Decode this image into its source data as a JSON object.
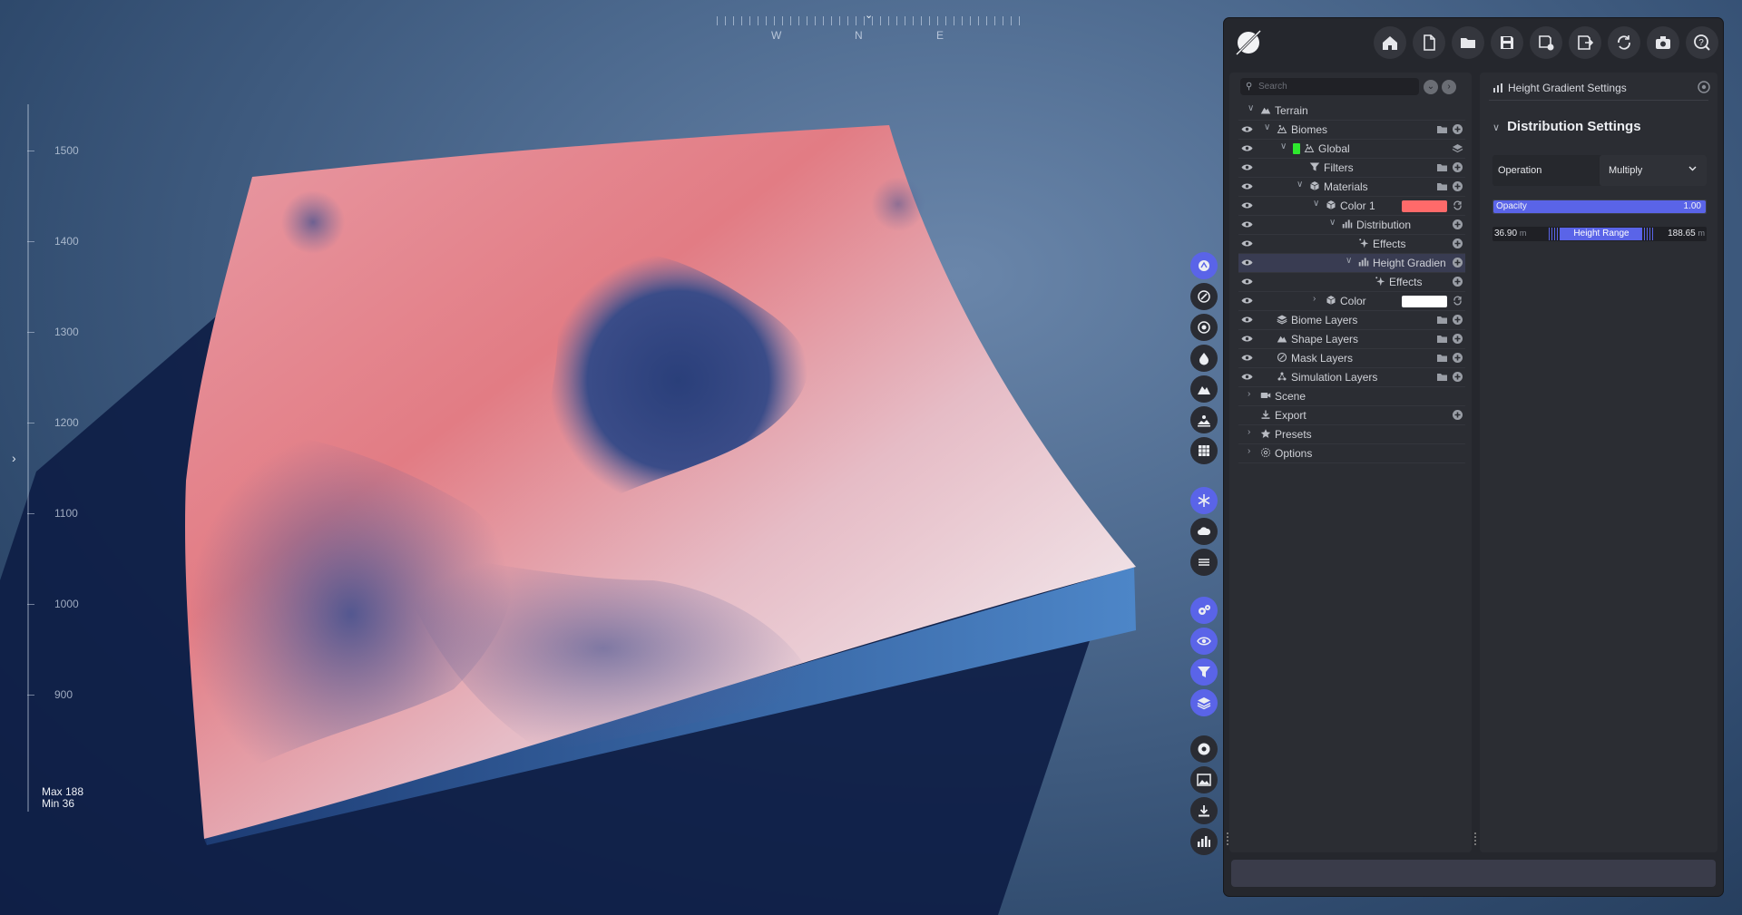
{
  "compass": {
    "labels": [
      "W",
      "N",
      "E"
    ]
  },
  "ruler": {
    "ticks": [
      "1500",
      "1400",
      "1300",
      "1200",
      "1100",
      "1000",
      "900"
    ],
    "max_label": "Max 188",
    "min_label": "Min 36"
  },
  "vtoolbar": {
    "groups": [
      [
        "sculpt-icon",
        "brush-icon",
        "erosion-icon",
        "water-drop-icon",
        "mountain-icon",
        "landscape-icon",
        "grid-icon"
      ],
      [
        "snowflake-icon",
        "cloud-icon",
        "wind-icon"
      ],
      [
        "gears-icon",
        "eye-icon",
        "filter-icon",
        "layers-icon"
      ],
      [
        "record-icon",
        "image-icon",
        "download-icon",
        "chart-icon"
      ]
    ],
    "active": [
      "sculpt-icon",
      "snowflake-icon",
      "gears-icon",
      "eye-icon",
      "filter-icon",
      "layers-icon"
    ]
  },
  "toolbar": {
    "buttons": [
      "home-icon",
      "new-file-icon",
      "open-folder-icon",
      "save-icon",
      "save-as-icon",
      "export-icon",
      "refresh-icon",
      "camera-icon",
      "help-icon"
    ]
  },
  "search": {
    "placeholder": "Search"
  },
  "tree": {
    "rows": [
      {
        "label": "Terrain",
        "depth": 0,
        "eye": false,
        "chev": "down",
        "icon": "mountain-icon"
      },
      {
        "label": "Biomes",
        "depth": 1,
        "eye": true,
        "chev": "down",
        "icon": "biome-icon",
        "actions": [
          "folder",
          "add"
        ]
      },
      {
        "label": "Global",
        "depth": 2,
        "eye": true,
        "chev": "down",
        "icon": "biome-icon",
        "green": true,
        "actions": [
          "stack"
        ]
      },
      {
        "label": "Filters",
        "depth": 3,
        "eye": true,
        "chev": "",
        "icon": "filter-icon",
        "actions": [
          "folder",
          "add"
        ]
      },
      {
        "label": "Materials",
        "depth": 3,
        "eye": true,
        "chev": "down",
        "icon": "cube-icon",
        "actions": [
          "folder",
          "add"
        ]
      },
      {
        "label": "Color 1",
        "depth": 4,
        "eye": true,
        "chev": "down",
        "icon": "cube-icon",
        "swatch": "#ff6a6a",
        "actions": [
          "refresh"
        ]
      },
      {
        "label": "Distribution",
        "depth": 5,
        "eye": true,
        "chev": "down",
        "icon": "chart-icon",
        "actions": [
          "add"
        ]
      },
      {
        "label": "Effects",
        "depth": 6,
        "eye": true,
        "chev": "",
        "icon": "sparkle-icon",
        "actions": [
          "add"
        ]
      },
      {
        "label": "Height Gradien",
        "depth": 6,
        "eye": true,
        "chev": "down",
        "icon": "chart-icon",
        "selected": true,
        "actions": [
          "add"
        ]
      },
      {
        "label": "Effects",
        "depth": 7,
        "eye": true,
        "chev": "",
        "icon": "sparkle-icon",
        "actions": [
          "add"
        ]
      },
      {
        "label": "Color",
        "depth": 4,
        "eye": true,
        "chev": "right",
        "icon": "cube-icon",
        "swatch": "#ffffff",
        "actions": [
          "refresh"
        ]
      },
      {
        "label": "Biome Layers",
        "depth": 1,
        "eye": true,
        "chev": "",
        "icon": "layers-icon",
        "actions": [
          "folder",
          "add"
        ]
      },
      {
        "label": "Shape Layers",
        "depth": 1,
        "eye": true,
        "chev": "",
        "icon": "mountain-icon",
        "actions": [
          "folder",
          "add"
        ]
      },
      {
        "label": "Mask Layers",
        "depth": 1,
        "eye": true,
        "chev": "",
        "icon": "brush-icon",
        "actions": [
          "folder",
          "add"
        ]
      },
      {
        "label": "Simulation Layers",
        "depth": 1,
        "eye": true,
        "chev": "",
        "icon": "sim-icon",
        "actions": [
          "folder",
          "add"
        ]
      },
      {
        "label": "Scene",
        "depth": 0,
        "eye": false,
        "chev": "right",
        "icon": "video-icon"
      },
      {
        "label": "Export",
        "depth": 0,
        "eye": false,
        "chev": "",
        "icon": "download-icon",
        "actions": [
          "add"
        ]
      },
      {
        "label": "Presets",
        "depth": 0,
        "eye": false,
        "chev": "right",
        "icon": "star-icon"
      },
      {
        "label": "Options",
        "depth": 0,
        "eye": false,
        "chev": "right",
        "icon": "gear-icon"
      }
    ]
  },
  "settings": {
    "title": "Height Gradient Settings",
    "section": "Distribution Settings",
    "operation_label": "Operation",
    "operation_value": "Multiply",
    "opacity_label": "Opacity",
    "opacity_value": "1.00",
    "opacity_fraction": 1.0,
    "range_low": "36.90",
    "range_high": "188.65",
    "range_unit": "m",
    "range_label": "Height Range"
  },
  "colors": {
    "accent": "#5a64e8",
    "panel": "#25272d",
    "swatch_color1": "#ff6a6a",
    "swatch_color": "#ffffff",
    "global_badge": "#2ee82e"
  }
}
